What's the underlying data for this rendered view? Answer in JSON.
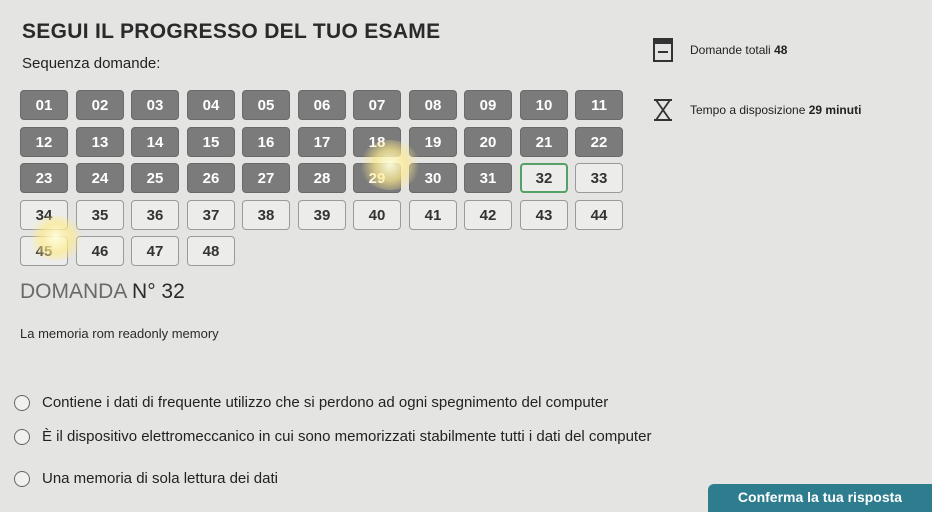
{
  "header": {
    "title": "SEGUI IL PROGRESSO DEL TUO ESAME",
    "sequence_label": "Sequenza domande:"
  },
  "info": {
    "total_label": "Domande totali",
    "total_value": "48",
    "time_label": "Tempo a disposizione",
    "time_value": "29 minuti"
  },
  "questions": [
    {
      "n": "01",
      "state": "answered"
    },
    {
      "n": "02",
      "state": "answered"
    },
    {
      "n": "03",
      "state": "answered"
    },
    {
      "n": "04",
      "state": "answered"
    },
    {
      "n": "05",
      "state": "answered"
    },
    {
      "n": "06",
      "state": "answered"
    },
    {
      "n": "07",
      "state": "answered"
    },
    {
      "n": "08",
      "state": "answered"
    },
    {
      "n": "09",
      "state": "answered"
    },
    {
      "n": "10",
      "state": "answered"
    },
    {
      "n": "11",
      "state": "answered"
    },
    {
      "n": "12",
      "state": "answered"
    },
    {
      "n": "13",
      "state": "answered"
    },
    {
      "n": "14",
      "state": "answered"
    },
    {
      "n": "15",
      "state": "answered"
    },
    {
      "n": "16",
      "state": "answered"
    },
    {
      "n": "17",
      "state": "answered"
    },
    {
      "n": "18",
      "state": "answered"
    },
    {
      "n": "19",
      "state": "answered"
    },
    {
      "n": "20",
      "state": "answered"
    },
    {
      "n": "21",
      "state": "answered"
    },
    {
      "n": "22",
      "state": "answered"
    },
    {
      "n": "23",
      "state": "answered"
    },
    {
      "n": "24",
      "state": "answered"
    },
    {
      "n": "25",
      "state": "answered"
    },
    {
      "n": "26",
      "state": "answered"
    },
    {
      "n": "27",
      "state": "answered"
    },
    {
      "n": "28",
      "state": "answered"
    },
    {
      "n": "29",
      "state": "answered"
    },
    {
      "n": "30",
      "state": "answered"
    },
    {
      "n": "31",
      "state": "answered"
    },
    {
      "n": "32",
      "state": "current"
    },
    {
      "n": "33",
      "state": "unanswered"
    },
    {
      "n": "34",
      "state": "unanswered"
    },
    {
      "n": "35",
      "state": "unanswered"
    },
    {
      "n": "36",
      "state": "unanswered"
    },
    {
      "n": "37",
      "state": "unanswered"
    },
    {
      "n": "38",
      "state": "unanswered"
    },
    {
      "n": "39",
      "state": "unanswered"
    },
    {
      "n": "40",
      "state": "unanswered"
    },
    {
      "n": "41",
      "state": "unanswered"
    },
    {
      "n": "42",
      "state": "unanswered"
    },
    {
      "n": "43",
      "state": "unanswered"
    },
    {
      "n": "44",
      "state": "unanswered"
    },
    {
      "n": "45",
      "state": "unanswered"
    },
    {
      "n": "46",
      "state": "unanswered"
    },
    {
      "n": "47",
      "state": "unanswered"
    },
    {
      "n": "48",
      "state": "unanswered"
    }
  ],
  "question": {
    "title_prefix": "DOMANDA",
    "title_number": "N° 32",
    "text": "La memoria rom readonly memory",
    "options": [
      "Contiene i dati di frequente utilizzo che si perdono ad ogni spegnimento del computer",
      "È il dispositivo elettromeccanico in cui sono memorizzati stabilmente tutti i dati del computer",
      "Una memoria di sola lettura dei dati"
    ]
  },
  "actions": {
    "confirm_label": "Conferma la tua risposta"
  },
  "colors": {
    "answered": "#7b7b7b",
    "current_border": "#55a066",
    "confirm": "#2d7d8e"
  }
}
